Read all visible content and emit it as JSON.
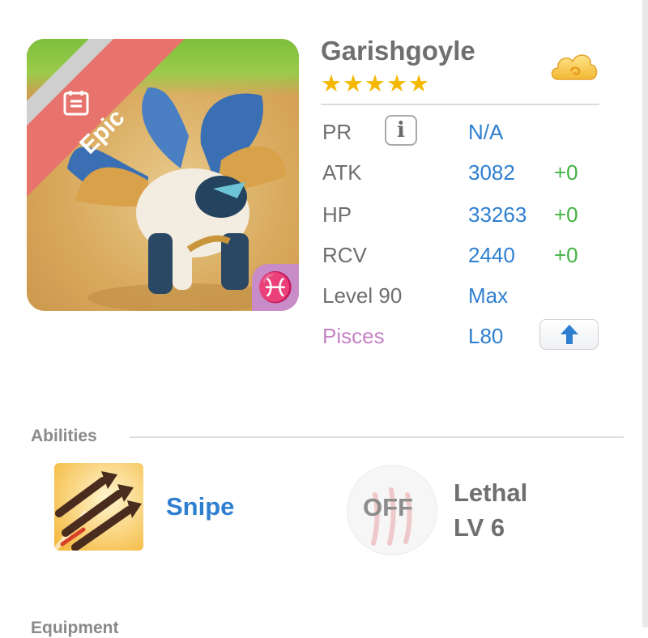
{
  "monster": {
    "name": "Garishgoyle",
    "rarity": "Epic",
    "stars": "★★★★★",
    "zodiac_symbol": "♓",
    "stats": {
      "pr_label": "PR",
      "pr_value": "N/A",
      "atk_label": "ATK",
      "atk_value": "3082",
      "atk_bonus": "+0",
      "hp_label": "HP",
      "hp_value": "33263",
      "hp_bonus": "+0",
      "rcv_label": "RCV",
      "rcv_value": "2440",
      "rcv_bonus": "+0",
      "level_label": "Level 90",
      "level_value": "Max",
      "sign_label": "Pisces",
      "sign_value": "L80"
    },
    "info_button": "i"
  },
  "abilities": {
    "label": "Abilities",
    "active": {
      "name": "Snipe"
    },
    "passive": {
      "toggle": "OFF",
      "name": "Lethal",
      "level": "LV 6"
    }
  },
  "equipment": {
    "label": "Equipment"
  },
  "icons": {
    "doc": "document-icon",
    "cloud": "cloud-currency-icon",
    "upgrade": "arrow-up-icon",
    "ability": "triple-arrow-icon",
    "claw": "claw-marks-icon"
  },
  "colors": {
    "value_blue": "#2f7fd0",
    "bonus_green": "#44b244",
    "pisces_purple": "#c583c5",
    "epic_red": "#e8736d",
    "star_gold": "#f5b800"
  }
}
